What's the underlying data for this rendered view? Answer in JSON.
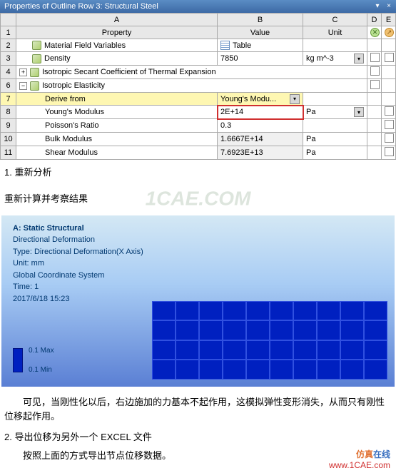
{
  "panel": {
    "title": "Properties of Outline Row 3: Structural Steel"
  },
  "columns": {
    "A": "A",
    "B": "B",
    "C": "C",
    "D": "D",
    "E": "E"
  },
  "headers": {
    "property": "Property",
    "value": "Value",
    "unit": "Unit"
  },
  "rows": {
    "r2": {
      "num": "2",
      "label": "Material Field Variables",
      "value": "Table"
    },
    "r3": {
      "num": "3",
      "label": "Density",
      "value": "7850",
      "unit": "kg m^-3"
    },
    "r4": {
      "num": "4",
      "label": "Isotropic Secant Coefficient of Thermal Expansion"
    },
    "r6": {
      "num": "6",
      "label": "Isotropic Elasticity"
    },
    "r7": {
      "num": "7",
      "label": "Derive from",
      "value": "Young's Modu..."
    },
    "r8": {
      "num": "8",
      "label": "Young's Modulus",
      "value": "2E+14",
      "unit": "Pa"
    },
    "r9": {
      "num": "9",
      "label": "Poisson's Ratio",
      "value": "0.3"
    },
    "r10": {
      "num": "10",
      "label": "Bulk Modulus",
      "value": "1.6667E+14",
      "unit": "Pa"
    },
    "r11": {
      "num": "11",
      "label": "Shear Modulus",
      "value": "7.6923E+13",
      "unit": "Pa"
    }
  },
  "text": {
    "step1": "1. 重新分析",
    "step1_sub": "重新计算并考察结果",
    "wm": "1CAE.COM",
    "conclusion": "　　可见，当刚性化以后，右边施加的力基本不起作用，这模拟弹性变形消失，从而只有刚性位移起作用。",
    "step2": "2. 导出位移为另外一个 EXCEL 文件",
    "step2_sub": "　　按照上面的方式导出节点位移数据。"
  },
  "viz": {
    "title": "A: Static Structural",
    "line2": "Directional Deformation",
    "line3": "Type: Directional Deformation(X Axis)",
    "line4": "Unit: mm",
    "line5": "Global Coordinate System",
    "line6": "Time: 1",
    "line7": "2017/6/18 15:23",
    "max": "0.1 Max",
    "min": "0.1 Min"
  },
  "footer": {
    "brand_pre": "仿真",
    "brand_post": "在线",
    "url": "www.1CAE.com"
  }
}
